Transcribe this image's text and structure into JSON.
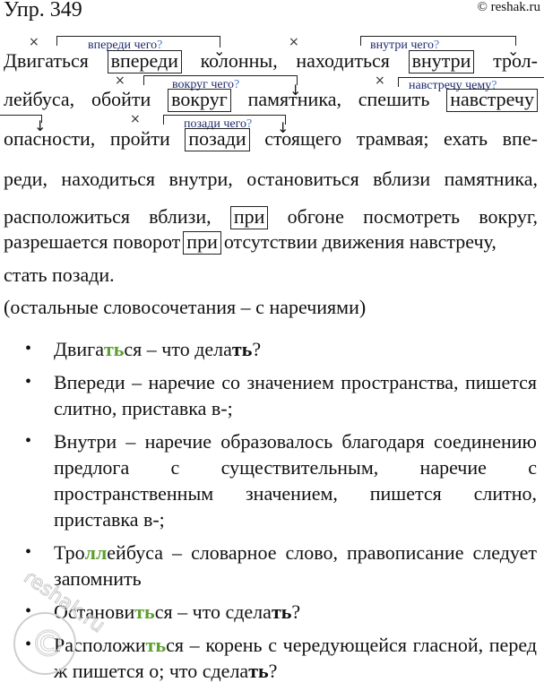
{
  "header": {
    "exercise": "Упр. 349",
    "copyright": "© reshak.ru"
  },
  "main": {
    "lines": [
      [
        "Двигаться",
        "впереди",
        "колонны,",
        "находиться",
        "внутри",
        "трол-"
      ],
      [
        "лейбуса,",
        "обойти",
        "вокруг",
        "памятника,",
        "спешить",
        "навстречу"
      ],
      [
        "опасности,",
        "пройти",
        "позади",
        "стоящего",
        "трамвая;",
        "ехать",
        "впе-"
      ],
      [
        "реди,",
        "находиться",
        "внутри,",
        "остановиться",
        "вблизи",
        "памятника,"
      ],
      [
        "расположиться",
        "вблизи,",
        "при",
        "обгоне",
        "посмотреть",
        "вокруг,"
      ],
      [
        "разрешается поворот",
        "при",
        "отсутствии движения навстречу,"
      ],
      [
        "стать позади."
      ]
    ],
    "annotations": [
      {
        "text": "впереди чего",
        "qmark": "?"
      },
      {
        "text": "внутри чего",
        "qmark": "?"
      },
      {
        "text": "вокруг чего",
        "qmark": "?"
      },
      {
        "text": "навстречу чему",
        "qmark": "?"
      },
      {
        "text": "позади чего",
        "qmark": "?"
      }
    ],
    "cross_mark": "×",
    "note": "(остальные словосочетания – с наречиями)"
  },
  "bullets": [
    {
      "parts": [
        {
          "t": "Двига"
        },
        {
          "t": "ть",
          "s": "g"
        },
        {
          "t": "ся – что дела"
        },
        {
          "t": "ть",
          "s": "b"
        },
        {
          "t": "?"
        }
      ]
    },
    {
      "parts": [
        {
          "t": "Впереди – наречие со значением пространства, пишется слитно, приставка в-;"
        }
      ]
    },
    {
      "parts": [
        {
          "t": "Внутри – наречие образовалось благодаря соединению предлога с существительным, наречие с пространственным значением, пишется слитно, приставка в-;"
        }
      ]
    },
    {
      "parts": [
        {
          "t": "Тро"
        },
        {
          "t": "лл",
          "s": "g"
        },
        {
          "t": "ейбуса – словарное слово, правописание следует запомнить"
        }
      ]
    },
    {
      "parts": [
        {
          "t": "Останови"
        },
        {
          "t": "ть",
          "s": "g"
        },
        {
          "t": "ся – что сдела"
        },
        {
          "t": "ть",
          "s": "b"
        },
        {
          "t": "?"
        }
      ]
    },
    {
      "parts": [
        {
          "t": "Расположи"
        },
        {
          "t": "ть",
          "s": "g"
        },
        {
          "t": "ся – корень с чередующейся гласной, перед ж пишется о; что сдела"
        },
        {
          "t": "ть",
          "s": "b"
        },
        {
          "t": "?"
        }
      ]
    }
  ],
  "bullet_glyph": "•",
  "watermark": "reshak.ru",
  "colors": {
    "highlight_green": "#5c9e2e",
    "annotation_text": "#1e2a6e",
    "annotation_qmark": "#4a7cc4"
  }
}
